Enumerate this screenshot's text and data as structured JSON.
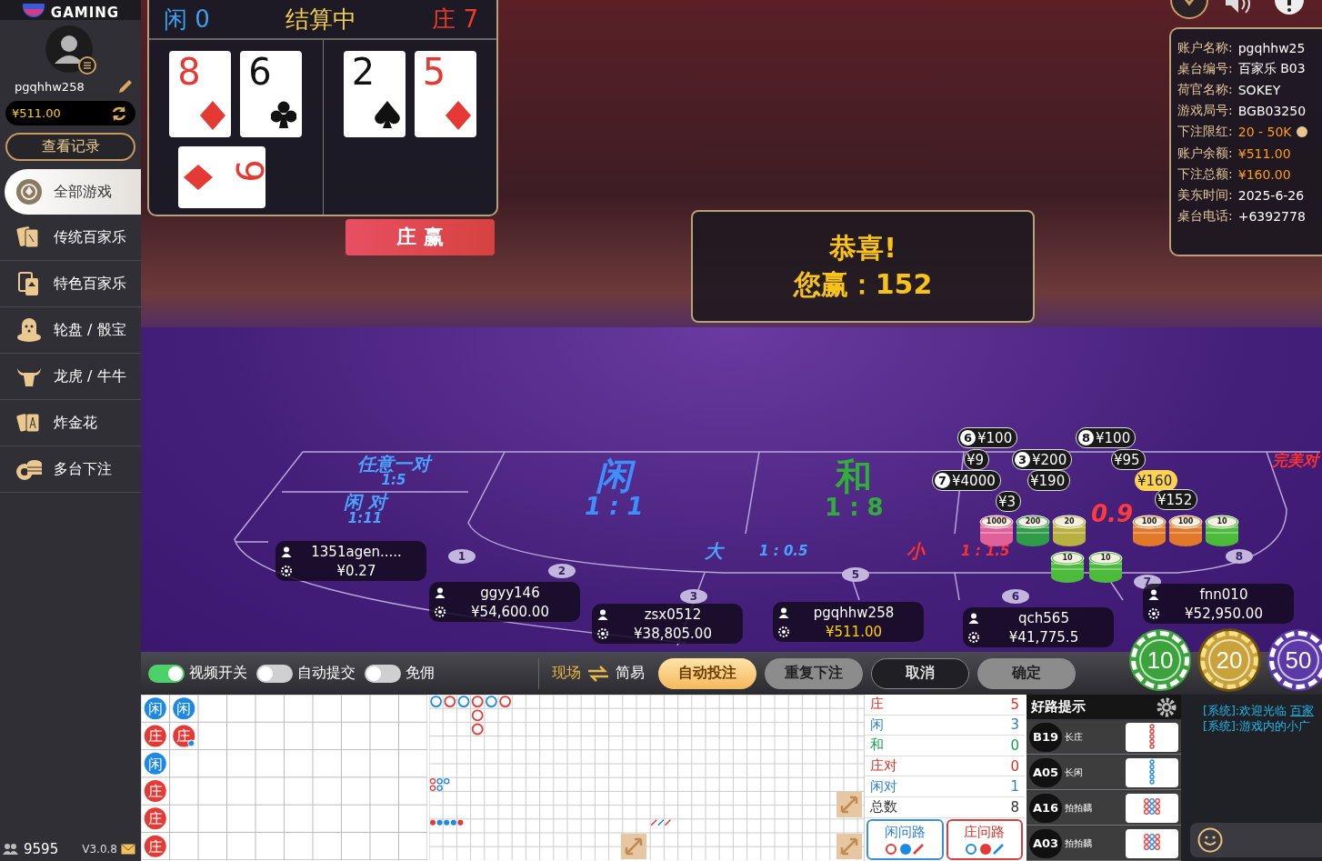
{
  "sidebar": {
    "logo": "GAMING",
    "username": "pgqhhw258",
    "balance": "¥511.00",
    "records_button": "查看记录",
    "menu": [
      {
        "label": "全部游戏",
        "kind": "chip",
        "selected": true
      },
      {
        "label": "传统百家乐",
        "kind": "cards",
        "selected": false
      },
      {
        "label": "特色百家乐",
        "kind": "card",
        "selected": false
      },
      {
        "label": "轮盘 / 骰宝",
        "kind": "dice",
        "selected": false
      },
      {
        "label": "龙虎 / 牛牛",
        "kind": "bull",
        "selected": false
      },
      {
        "label": "炸金花",
        "kind": "fan",
        "selected": false
      },
      {
        "label": "多台下注",
        "kind": "chips",
        "selected": false
      }
    ],
    "online_count": "9595",
    "version": "V3.0.8"
  },
  "result_panel": {
    "player_score": "闲 0",
    "status": "结算中",
    "banker_score": "庄 7",
    "player_cards": [
      {
        "rank": "8",
        "kind": "diamond",
        "rotated": false
      },
      {
        "rank": "6",
        "kind": "club",
        "rotated": false
      },
      {
        "rank": "9",
        "kind": "diamond",
        "rotated": true
      }
    ],
    "banker_cards": [
      {
        "rank": "2",
        "kind": "spade",
        "rotated": false
      },
      {
        "rank": "5",
        "kind": "diamond",
        "rotated": false
      }
    ],
    "winner_banner": "庄 赢"
  },
  "congrats": {
    "title": "恭喜!",
    "message": "您赢：152"
  },
  "table_info": [
    {
      "label": "账户名称:",
      "value": "pgqhhw25",
      "kind": "plain"
    },
    {
      "label": "桌台编号:",
      "value": "百家乐 B03",
      "kind": "plain"
    },
    {
      "label": "荷官名称:",
      "value": "SOKEY",
      "kind": "plain"
    },
    {
      "label": "游戏局号:",
      "value": "BGB03250",
      "kind": "plain"
    },
    {
      "label": "下注限红:",
      "value": "20 - 50K",
      "kind": "money"
    },
    {
      "label": "账户余额:",
      "value": "¥511.00",
      "kind": "money"
    },
    {
      "label": "下注总额:",
      "value": "¥160.00",
      "kind": "money"
    },
    {
      "label": "美东时间:",
      "value": "2025-6-26",
      "kind": "plain"
    },
    {
      "label": "桌台电话:",
      "value": "+6392778",
      "kind": "plain"
    }
  ],
  "bet_zones": [
    {
      "name": "任意一对",
      "odds": "1:5",
      "kind": "player_side"
    },
    {
      "name": "闲 对",
      "odds": "1:11",
      "kind": "player_side"
    },
    {
      "name": "闲",
      "odds": "1 : 1",
      "kind": "player_main"
    },
    {
      "name": "和",
      "odds": "1 : 8",
      "kind": "tie"
    },
    {
      "name": "大",
      "odds": "1 : 0.5",
      "kind": "player_side"
    },
    {
      "name": "小",
      "odds": "1 : 1.5",
      "kind": "banker_side"
    },
    {
      "odds": "0.9",
      "kind": "banker_main"
    },
    {
      "name": "完美对",
      "kind": "banker_side"
    }
  ],
  "seat_numbers": [
    "1",
    "2",
    "3",
    "5",
    "6",
    "7",
    "8"
  ],
  "seats": [
    {
      "name": "1351agen.....",
      "amount": "¥0.27",
      "self": false
    },
    {
      "name": "ggyy146",
      "amount": "¥54,600.00",
      "self": false
    },
    {
      "name": "zsx0512",
      "amount": "¥38,805.00",
      "self": false
    },
    {
      "name": "pgqhhw258",
      "amount": "¥511.00",
      "self": true
    },
    {
      "name": "qch565",
      "amount": "¥41,775.5",
      "self": false
    },
    {
      "name": "fnn010",
      "amount": "¥52,950.00",
      "self": false
    }
  ],
  "table_chips": [
    {
      "label": "1000",
      "color": "#e0609a"
    },
    {
      "label": "200",
      "color": "#2f9c4a"
    },
    {
      "label": "20",
      "color": "#b8b040"
    },
    {
      "label": "100",
      "color": "#e07a2a"
    },
    {
      "label": "100",
      "color": "#e07a2a"
    },
    {
      "label": "10",
      "color": "#4cbb3c"
    },
    {
      "label": "10",
      "color": "#4cbb3c"
    },
    {
      "label": "10",
      "color": "#4cbb3c"
    }
  ],
  "bet_bubbles": [
    {
      "seat": "6",
      "amount": "¥100",
      "self": false
    },
    {
      "amount": "¥9",
      "self": false
    },
    {
      "seat": "3",
      "amount": "¥200",
      "self": false
    },
    {
      "seat": "7",
      "amount": "¥4000",
      "self": false
    },
    {
      "amount": "¥190",
      "self": false
    },
    {
      "seat": "8",
      "amount": "¥100",
      "self": false
    },
    {
      "amount": "¥95",
      "self": false
    },
    {
      "amount": "¥160",
      "self": true
    },
    {
      "amount": "¥152",
      "self": false
    },
    {
      "amount": "¥3",
      "self": false
    }
  ],
  "toolbar": {
    "toggles": [
      {
        "label": "视频开关",
        "on": true
      },
      {
        "label": "自动提交",
        "on": false
      },
      {
        "label": "免佣",
        "on": false
      }
    ],
    "view_modes": [
      {
        "label": "现场",
        "selected": true
      },
      {
        "label": "简易",
        "selected": false
      }
    ],
    "buttons": [
      {
        "label": "自动投注",
        "kind": "primary"
      },
      {
        "label": "重复下注",
        "kind": "secondary"
      },
      {
        "label": "取消",
        "kind": "dark"
      },
      {
        "label": "确定",
        "kind": "secondary"
      }
    ],
    "chips": [
      {
        "label": "10",
        "color": "#3ca33c",
        "selected": false
      },
      {
        "label": "20",
        "color": "#c9a23a",
        "selected": true
      },
      {
        "label": "50",
        "color": "#5b3aa8",
        "selected": false
      }
    ]
  },
  "bead_road": [
    {
      "label": "闲",
      "kind": "player",
      "pair": false
    },
    {
      "label": "庄",
      "kind": "banker",
      "pair": false
    },
    {
      "label": "闲",
      "kind": "player",
      "pair": false
    },
    {
      "label": "庄",
      "kind": "banker",
      "pair": false
    },
    {
      "label": "庄",
      "kind": "banker",
      "pair": false
    },
    {
      "label": "庄",
      "kind": "banker",
      "pair": false
    },
    {
      "label": "闲",
      "kind": "player",
      "pair": false
    },
    {
      "label": "庄",
      "kind": "banker",
      "pair": true
    }
  ],
  "big_road": [
    [
      {
        "kind": "player"
      }
    ],
    [
      {
        "kind": "banker"
      }
    ],
    [
      {
        "kind": "player"
      }
    ],
    [
      {
        "kind": "banker"
      },
      {
        "kind": "banker"
      },
      {
        "kind": "banker"
      }
    ],
    [
      {
        "kind": "player"
      }
    ],
    [
      {
        "kind": "banker"
      }
    ]
  ],
  "big_eye_road": [
    [
      {
        "kind": "banker"
      },
      {
        "kind": "banker"
      }
    ],
    [
      {
        "kind": "player"
      },
      {
        "kind": "player"
      }
    ],
    [
      {
        "kind": "player"
      }
    ]
  ],
  "small_road": [
    [
      {
        "kind": "banker"
      }
    ],
    [
      {
        "kind": "player"
      }
    ],
    [
      {
        "kind": "player"
      }
    ],
    [
      {
        "kind": "player"
      }
    ],
    [
      {
        "kind": "banker"
      }
    ]
  ],
  "cockroach_road": [
    [
      {
        "kind": "banker"
      }
    ],
    [
      {
        "kind": "player"
      }
    ],
    [
      {
        "kind": "banker"
      }
    ]
  ],
  "stats": [
    {
      "label": "庄",
      "value": "5",
      "kind": "banker"
    },
    {
      "label": "闲",
      "value": "3",
      "kind": "player"
    },
    {
      "label": "和",
      "value": "0",
      "kind": "tie"
    },
    {
      "label": "庄对",
      "value": "0",
      "kind": "banker"
    },
    {
      "label": "闲对",
      "value": "1",
      "kind": "player"
    },
    {
      "label": "总数",
      "value": "8",
      "kind": "total"
    }
  ],
  "ask_road": [
    {
      "label": "闲问路",
      "kind": "player",
      "predictions": [
        {
          "kind": "banker"
        },
        {
          "kind": "player"
        },
        {
          "kind": "banker"
        }
      ]
    },
    {
      "label": "庄问路",
      "kind": "banker",
      "predictions": [
        {
          "kind": "player"
        },
        {
          "kind": "banker"
        },
        {
          "kind": "player"
        }
      ]
    }
  ],
  "good_roads": {
    "title": "好路提示",
    "items": [
      {
        "table": "B19",
        "pattern": "长庄",
        "kind": "long_banker"
      },
      {
        "table": "A05",
        "pattern": "长闲",
        "kind": "long_player"
      },
      {
        "table": "A16",
        "pattern": "拍拍黐",
        "kind": "ping_pong"
      },
      {
        "table": "A03",
        "pattern": "拍拍黐",
        "kind": "ping_pong"
      }
    ]
  },
  "chat": [
    {
      "text": "[系统]:欢迎光临 ",
      "link": "百家"
    },
    {
      "text": "[系统]:游戏内的小广"
    }
  ]
}
